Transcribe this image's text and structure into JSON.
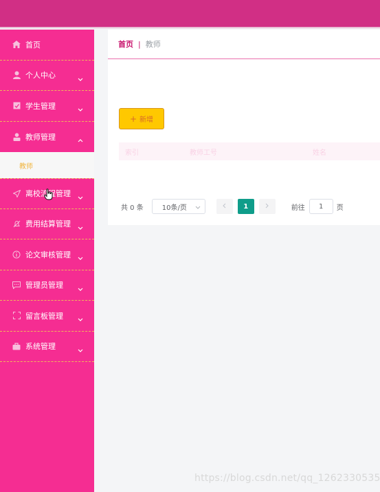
{
  "sidebar": {
    "items": [
      {
        "label": "首页",
        "icon": "home-icon",
        "has_chevron": false
      },
      {
        "label": "个人中心",
        "icon": "user-icon",
        "has_chevron": true
      },
      {
        "label": "学生管理",
        "icon": "edit-icon",
        "has_chevron": true
      },
      {
        "label": "教师管理",
        "icon": "person-icon",
        "has_chevron": true,
        "expanded": true
      },
      {
        "label": "离校流程管理",
        "icon": "send-icon",
        "has_chevron": true
      },
      {
        "label": "费用结算管理",
        "icon": "bell-off-icon",
        "has_chevron": true
      },
      {
        "label": "论文审核管理",
        "icon": "circle-info-icon",
        "has_chevron": true
      },
      {
        "label": "管理员管理",
        "icon": "chat-icon",
        "has_chevron": true
      },
      {
        "label": "留言板管理",
        "icon": "full-screen-icon",
        "has_chevron": true
      },
      {
        "label": "系统管理",
        "icon": "briefcase-icon",
        "has_chevron": true
      }
    ],
    "submenu_active": "教师"
  },
  "breadcrumb": {
    "home": "首页",
    "separator": "|",
    "current": "教师"
  },
  "toolbar": {
    "add_label": "新增"
  },
  "table": {
    "headers": [
      "索引",
      "教师工号",
      "姓名"
    ],
    "rows": []
  },
  "pagination": {
    "total_text": "共 0 条",
    "page_size": "10条/页",
    "current_page": "1",
    "goto_label": "前往",
    "goto_value": "1",
    "page_unit": "页"
  },
  "watermark": "https://blog.csdn.net/qq_1262330535",
  "colors": {
    "topbar": "#d12f85",
    "sidebar": "#f52d92",
    "accent": "#c8166e",
    "submenu_text": "#f0b43c",
    "add_button": "#ffc800",
    "page_active": "#0f9d8a"
  }
}
